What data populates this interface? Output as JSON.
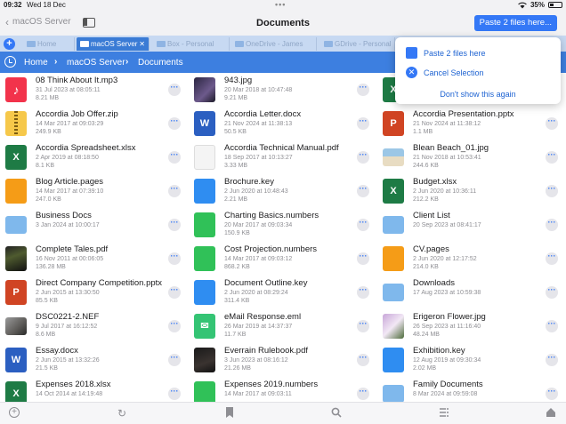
{
  "status": {
    "time": "09:32",
    "date": "Wed 18 Dec",
    "battery": "35%",
    "battery_level": 0.35
  },
  "nav": {
    "back_label": "macOS Server",
    "title": "Documents",
    "paste_button": "Paste 2 files here..."
  },
  "tabs": [
    {
      "label": "Home"
    },
    {
      "label": "macOS Server"
    },
    {
      "label": "Box - Personal"
    },
    {
      "label": "OneDrive - James"
    },
    {
      "label": "GDrive - Personal"
    }
  ],
  "breadcrumb": [
    "Home",
    "macOS Server",
    "Documents"
  ],
  "popover": {
    "paste": "Paste 2 files here",
    "cancel": "Cancel Selection",
    "dont_show": "Don't show this again"
  },
  "files": [
    {
      "name": "08 Think About It.mp3",
      "date": "31 Jul 2023 at 08:05:11",
      "size": "8.21 MB",
      "icon": "music-icon"
    },
    {
      "name": "943.jpg",
      "date": "20 Mar 2018 at 10:47:48",
      "size": "9.21 MB",
      "icon": "photo-icon"
    },
    {
      "name": "",
      "date": "",
      "size": "",
      "icon": "excel-icon"
    },
    {
      "name": "Accordia Job Offer.zip",
      "date": "14 Mar 2017 at 09:03:29",
      "size": "249.9 KB",
      "icon": "zip-icon"
    },
    {
      "name": "Accordia Letter.docx",
      "date": "21 Nov 2024 at 11:38:13",
      "size": "50.5 KB",
      "icon": "word-icon"
    },
    {
      "name": "Accordia Presentation.pptx",
      "date": "21 Nov 2024 at 11:38:12",
      "size": "1.1 MB",
      "icon": "powerpoint-icon"
    },
    {
      "name": "Accordia Spreadsheet.xlsx",
      "date": "2 Apr 2019 at 08:18:50",
      "size": "8.1 KB",
      "icon": "excel-icon"
    },
    {
      "name": "Accordia Technical Manual.pdf",
      "date": "18 Sep 2017 at 10:13:27",
      "size": "3.33 MB",
      "icon": "pdf-icon"
    },
    {
      "name": "Blean Beach_01.jpg",
      "date": "21 Nov 2018 at 10:53:41",
      "size": "244.6 KB",
      "icon": "photo-icon"
    },
    {
      "name": "Blog Article.pages",
      "date": "14 Mar 2017 at 07:39:10",
      "size": "247.0 KB",
      "icon": "pages-icon"
    },
    {
      "name": "Brochure.key",
      "date": "2 Jun 2020 at 10:48:43",
      "size": "2.21 MB",
      "icon": "keynote-icon"
    },
    {
      "name": "Budget.xlsx",
      "date": "2 Jun 2020 at 10:36:11",
      "size": "212.2 KB",
      "icon": "excel-icon"
    },
    {
      "name": "Business Docs",
      "date": "3 Jan 2024 at 10:00:17",
      "size": "",
      "icon": "folder-icon"
    },
    {
      "name": "Charting Basics.numbers",
      "date": "20 Mar 2017 at 09:03:34",
      "size": "150.9 KB",
      "icon": "numbers-icon"
    },
    {
      "name": "Client List",
      "date": "20 Sep 2023 at 08:41:17",
      "size": "",
      "icon": "folder-icon"
    },
    {
      "name": "Complete Tales.pdf",
      "date": "16 Nov 2011 at 00:06:05",
      "size": "136.28 MB",
      "icon": "photo-icon"
    },
    {
      "name": "Cost Projection.numbers",
      "date": "14 Mar 2017 at 09:03:12",
      "size": "868.2 KB",
      "icon": "numbers-icon"
    },
    {
      "name": "CV.pages",
      "date": "2 Jun 2020 at 12:17:52",
      "size": "214.0 KB",
      "icon": "pages-icon"
    },
    {
      "name": "Direct Company Competition.pptx",
      "date": "2 Jun 2015 at 13:30:50",
      "size": "85.5 KB",
      "icon": "powerpoint-icon"
    },
    {
      "name": "Document Outline.key",
      "date": "2 Jun 2020 at 08:29:24",
      "size": "311.4 KB",
      "icon": "keynote-icon"
    },
    {
      "name": "Downloads",
      "date": "17 Aug 2023 at 10:59:38",
      "size": "",
      "icon": "folder-icon"
    },
    {
      "name": "DSC0221-2.NEF",
      "date": "9 Jul 2017 at 16:12:52",
      "size": "8.6 MB",
      "icon": "photo-icon"
    },
    {
      "name": "eMail Response.eml",
      "date": "26 Mar 2019 at 14:37:37",
      "size": "11.7 KB",
      "icon": "mail-icon"
    },
    {
      "name": "Erigeron Flower.jpg",
      "date": "26 Sep 2023 at 11:16:40",
      "size": "48.24 MB",
      "icon": "photo-icon"
    },
    {
      "name": "Essay.docx",
      "date": "2 Jun 2015 at 13:32:26",
      "size": "21.5 KB",
      "icon": "word-icon"
    },
    {
      "name": "Everrain Rulebook.pdf",
      "date": "3 Jun 2023 at 08:16:12",
      "size": "21.26 MB",
      "icon": "photo-icon"
    },
    {
      "name": "Exhibition.key",
      "date": "12 Aug 2019 at 09:30:34",
      "size": "2.02 MB",
      "icon": "keynote-icon"
    },
    {
      "name": "Expenses 2018.xlsx",
      "date": "14 Oct 2014 at 14:19:48",
      "size": "",
      "icon": "excel-icon"
    },
    {
      "name": "Expenses 2019.numbers",
      "date": "14 Mar 2017 at 09:03:11",
      "size": "",
      "icon": "numbers-icon"
    },
    {
      "name": "Family Documents",
      "date": "8 Mar 2024 at 09:59:08",
      "size": "",
      "icon": "folder-icon"
    }
  ]
}
